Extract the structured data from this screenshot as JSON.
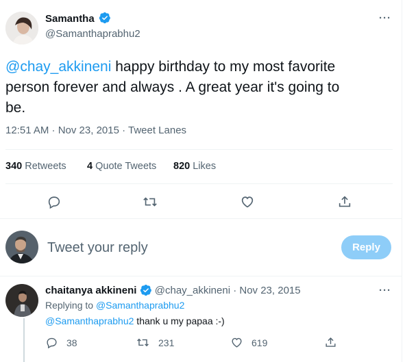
{
  "tweet": {
    "author_name": "Samantha",
    "author_handle": "@Samanthaprabhu2",
    "mention": "@chay_akkineni",
    "text_line1": " happy birthday to my most favorite",
    "text_line2": "person forever and always . A great year it's going to",
    "text_line3": "be.",
    "timestamp": "12:51 AM · Nov 23, 2015 · Tweet Lanes",
    "retweets_count": "340",
    "retweets_label": "Retweets",
    "quote_count": "4",
    "quote_label": "Quote Tweets",
    "likes_count": "820",
    "likes_label": "Likes"
  },
  "composer": {
    "placeholder": "Tweet your reply",
    "reply_button": "Reply"
  },
  "reply": {
    "author_name": "chaitanya akkineni",
    "author_handle_date": "@chay_akkineni · Nov 23, 2015",
    "replying_prefix": "Replying to ",
    "replying_to": "@Samanthaprabhu2",
    "mention": "@Samanthaprabhu2",
    "text": " thank u my papaa :-)",
    "reply_count": "38",
    "retweet_count": "231",
    "like_count": "619"
  },
  "colors": {
    "accent": "#1d9bf0",
    "reply_button_disabled": "#8ecdf8",
    "secondary_text": "#536471"
  },
  "icons": [
    "more-icon",
    "verified-badge-icon",
    "reply-icon",
    "retweet-icon",
    "like-icon",
    "share-icon"
  ]
}
